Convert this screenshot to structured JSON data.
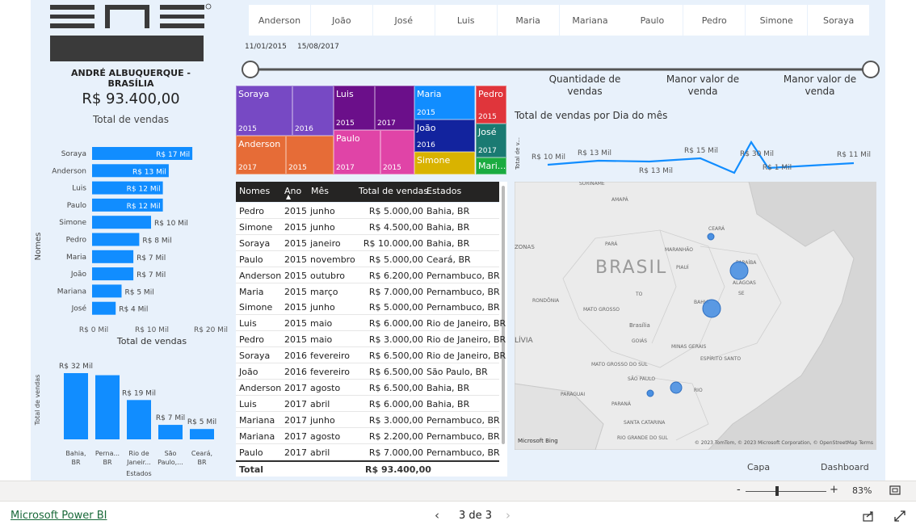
{
  "header": {
    "logo_text": "ENS",
    "person": "ANDRÉ ALBUQUERQUE - BRASÍLIA",
    "total_value": "R$ 93.400,00",
    "total_label": "Total de vendas"
  },
  "slicer_names": [
    "Anderson",
    "João",
    "José",
    "Luis",
    "Maria",
    "Mariana",
    "Paulo",
    "Pedro",
    "Simone",
    "Soraya"
  ],
  "date_range": {
    "start": "11/01/2015",
    "end": "15/08/2017"
  },
  "metrics": {
    "quantidade": "Quantidade de vendas",
    "menor1": "Manor valor de venda",
    "menor2": "Manor valor de venda"
  },
  "bar_chart": {
    "y_label": "Nomes",
    "x_label": "Total de vendas",
    "ticks": [
      "R$ 0 Mil",
      "R$ 10 Mil",
      "R$ 20 Mil"
    ]
  },
  "state_chart": {
    "y_label": "Total de vendas",
    "x_label": "Estados"
  },
  "line_chart": {
    "title": "Total de vendas por Dia do mês",
    "y_label": "Total de v..."
  },
  "treemap": {
    "cells": [
      {
        "name": "Soraya",
        "year": "2015"
      },
      {
        "name": "",
        "year": "2016"
      },
      {
        "name": "Luis",
        "year": "2015"
      },
      {
        "name": "",
        "year": "2017"
      },
      {
        "name": "Maria",
        "year": "2015"
      },
      {
        "name": "Pedro",
        "year": "2015"
      },
      {
        "name": "Anderson",
        "year": "2017"
      },
      {
        "name": "",
        "year": "2015"
      },
      {
        "name": "Paulo",
        "year": "2017"
      },
      {
        "name": "",
        "year": "2015"
      },
      {
        "name": "João",
        "year": "2016"
      },
      {
        "name": "José",
        "year": "2017"
      },
      {
        "name": "Simone",
        "year": ""
      },
      {
        "name": "Mari...",
        "year": ""
      }
    ]
  },
  "table": {
    "headers": [
      "Nomes",
      "Ano",
      "Mês",
      "Total de vendas",
      "Estados"
    ],
    "rows": [
      [
        "Pedro",
        "2015",
        "junho",
        "R$ 5.000,00",
        "Bahia, BR"
      ],
      [
        "Simone",
        "2015",
        "junho",
        "R$ 4.500,00",
        "Bahia, BR"
      ],
      [
        "Soraya",
        "2015",
        "janeiro",
        "R$ 10.000,00",
        "Bahia, BR"
      ],
      [
        "Paulo",
        "2015",
        "novembro",
        "R$ 5.000,00",
        "Ceará, BR"
      ],
      [
        "Anderson",
        "2015",
        "outubro",
        "R$ 6.200,00",
        "Pernambuco, BR"
      ],
      [
        "Maria",
        "2015",
        "março",
        "R$ 7.000,00",
        "Pernambuco, BR"
      ],
      [
        "Simone",
        "2015",
        "junho",
        "R$ 5.000,00",
        "Pernambuco, BR"
      ],
      [
        "Luis",
        "2015",
        "maio",
        "R$ 6.000,00",
        "Rio de Janeiro, BR"
      ],
      [
        "Pedro",
        "2015",
        "maio",
        "R$ 3.000,00",
        "Rio de Janeiro, BR"
      ],
      [
        "Soraya",
        "2016",
        "fevereiro",
        "R$ 6.500,00",
        "Rio de Janeiro, BR"
      ],
      [
        "João",
        "2016",
        "fevereiro",
        "R$ 6.500,00",
        "São Paulo, BR"
      ],
      [
        "Anderson",
        "2017",
        "agosto",
        "R$ 6.500,00",
        "Bahia, BR"
      ],
      [
        "Luis",
        "2017",
        "abril",
        "R$ 6.000,00",
        "Bahia, BR"
      ],
      [
        "Mariana",
        "2017",
        "junho",
        "R$ 3.000,00",
        "Pernambuco, BR"
      ],
      [
        "Mariana",
        "2017",
        "agosto",
        "R$ 2.200,00",
        "Pernambuco, BR"
      ],
      [
        "Paulo",
        "2017",
        "abril",
        "R$ 7.000,00",
        "Pernambuco, BR"
      ]
    ],
    "total_label": "Total",
    "total_value": "R$ 93.400,00"
  },
  "map": {
    "labels": [
      "SURINAME",
      "AMAPÁ",
      "CEARÁ",
      "PARÁ",
      "MARANHÃO",
      "PIAUÍ",
      "PARAÍBA",
      "ALAGOAS",
      "SE",
      "BRASIL",
      "RONDÔNIA",
      "MATO GROSSO",
      "TO",
      "BAHIA",
      "Brasília",
      "GOIÁS",
      "MINAS GERAIS",
      "ESPÍRITO SANTO",
      "MATO GROSSO DO SUL",
      "SÃO PAULO",
      "RIO",
      "PARAGUAI",
      "PARANÁ",
      "SANTA CATARINA",
      "RIO GRANDE DO SUL",
      "ZONAS",
      "LÍVIA"
    ],
    "attribution": "© 2023 TomTom, © 2023 Microsoft Corporation, © OpenStreetMap  Terms",
    "bing": "Microsoft Bing"
  },
  "pages": {
    "capa": "Capa",
    "dashboard": "Dashboard"
  },
  "zoom": {
    "minus": "-",
    "plus": "+",
    "value": "83%"
  },
  "footer": {
    "brand": "Microsoft Power BI",
    "page_indicator": "3 de 3"
  },
  "chart_data": [
    {
      "type": "bar",
      "orientation": "horizontal",
      "categories": [
        "Soraya",
        "Anderson",
        "Luis",
        "Paulo",
        "Simone",
        "Pedro",
        "Maria",
        "João",
        "Mariana",
        "José"
      ],
      "values": [
        17,
        13,
        12,
        12,
        10,
        8,
        7,
        7,
        5,
        4
      ],
      "value_labels": [
        "R$ 17 Mil",
        "R$ 13 Mil",
        "R$ 12 Mil",
        "R$ 12 Mil",
        "R$ 10 Mil",
        "R$ 8 Mil",
        "R$ 7 Mil",
        "R$ 7 Mil",
        "R$ 5 Mil",
        "R$ 4 Mil"
      ],
      "xlabel": "Total de vendas",
      "ylabel": "Nomes",
      "xlim": [
        0,
        20
      ],
      "color": "#118dff"
    },
    {
      "type": "bar",
      "categories": [
        "Bahia, BR",
        "Perna... BR",
        "Rio de Janeir...",
        "São Paulo,...",
        "Ceará, BR"
      ],
      "values": [
        32,
        31,
        19,
        7,
        5
      ],
      "value_labels": [
        "R$ 32 Mil",
        "",
        "R$ 19 Mil",
        "R$ 7 Mil",
        "R$ 5 Mil"
      ],
      "xlabel": "Estados",
      "ylabel": "Total de vendas",
      "ylim": [
        0,
        35
      ],
      "color": "#118dff"
    },
    {
      "type": "line",
      "title": "Total de vendas por Dia do mês",
      "ylabel": "Total de v...",
      "values": [
        10,
        13,
        13,
        15,
        6,
        30,
        1,
        11
      ],
      "value_labels": [
        "R$ 10 Mil",
        "R$ 13 Mil",
        "R$ 13 Mil",
        "R$ 15 Mil",
        "",
        "R$ 30 Mil",
        "R$ 1 Mil",
        "R$ 11 Mil"
      ],
      "color": "#118dff"
    }
  ]
}
